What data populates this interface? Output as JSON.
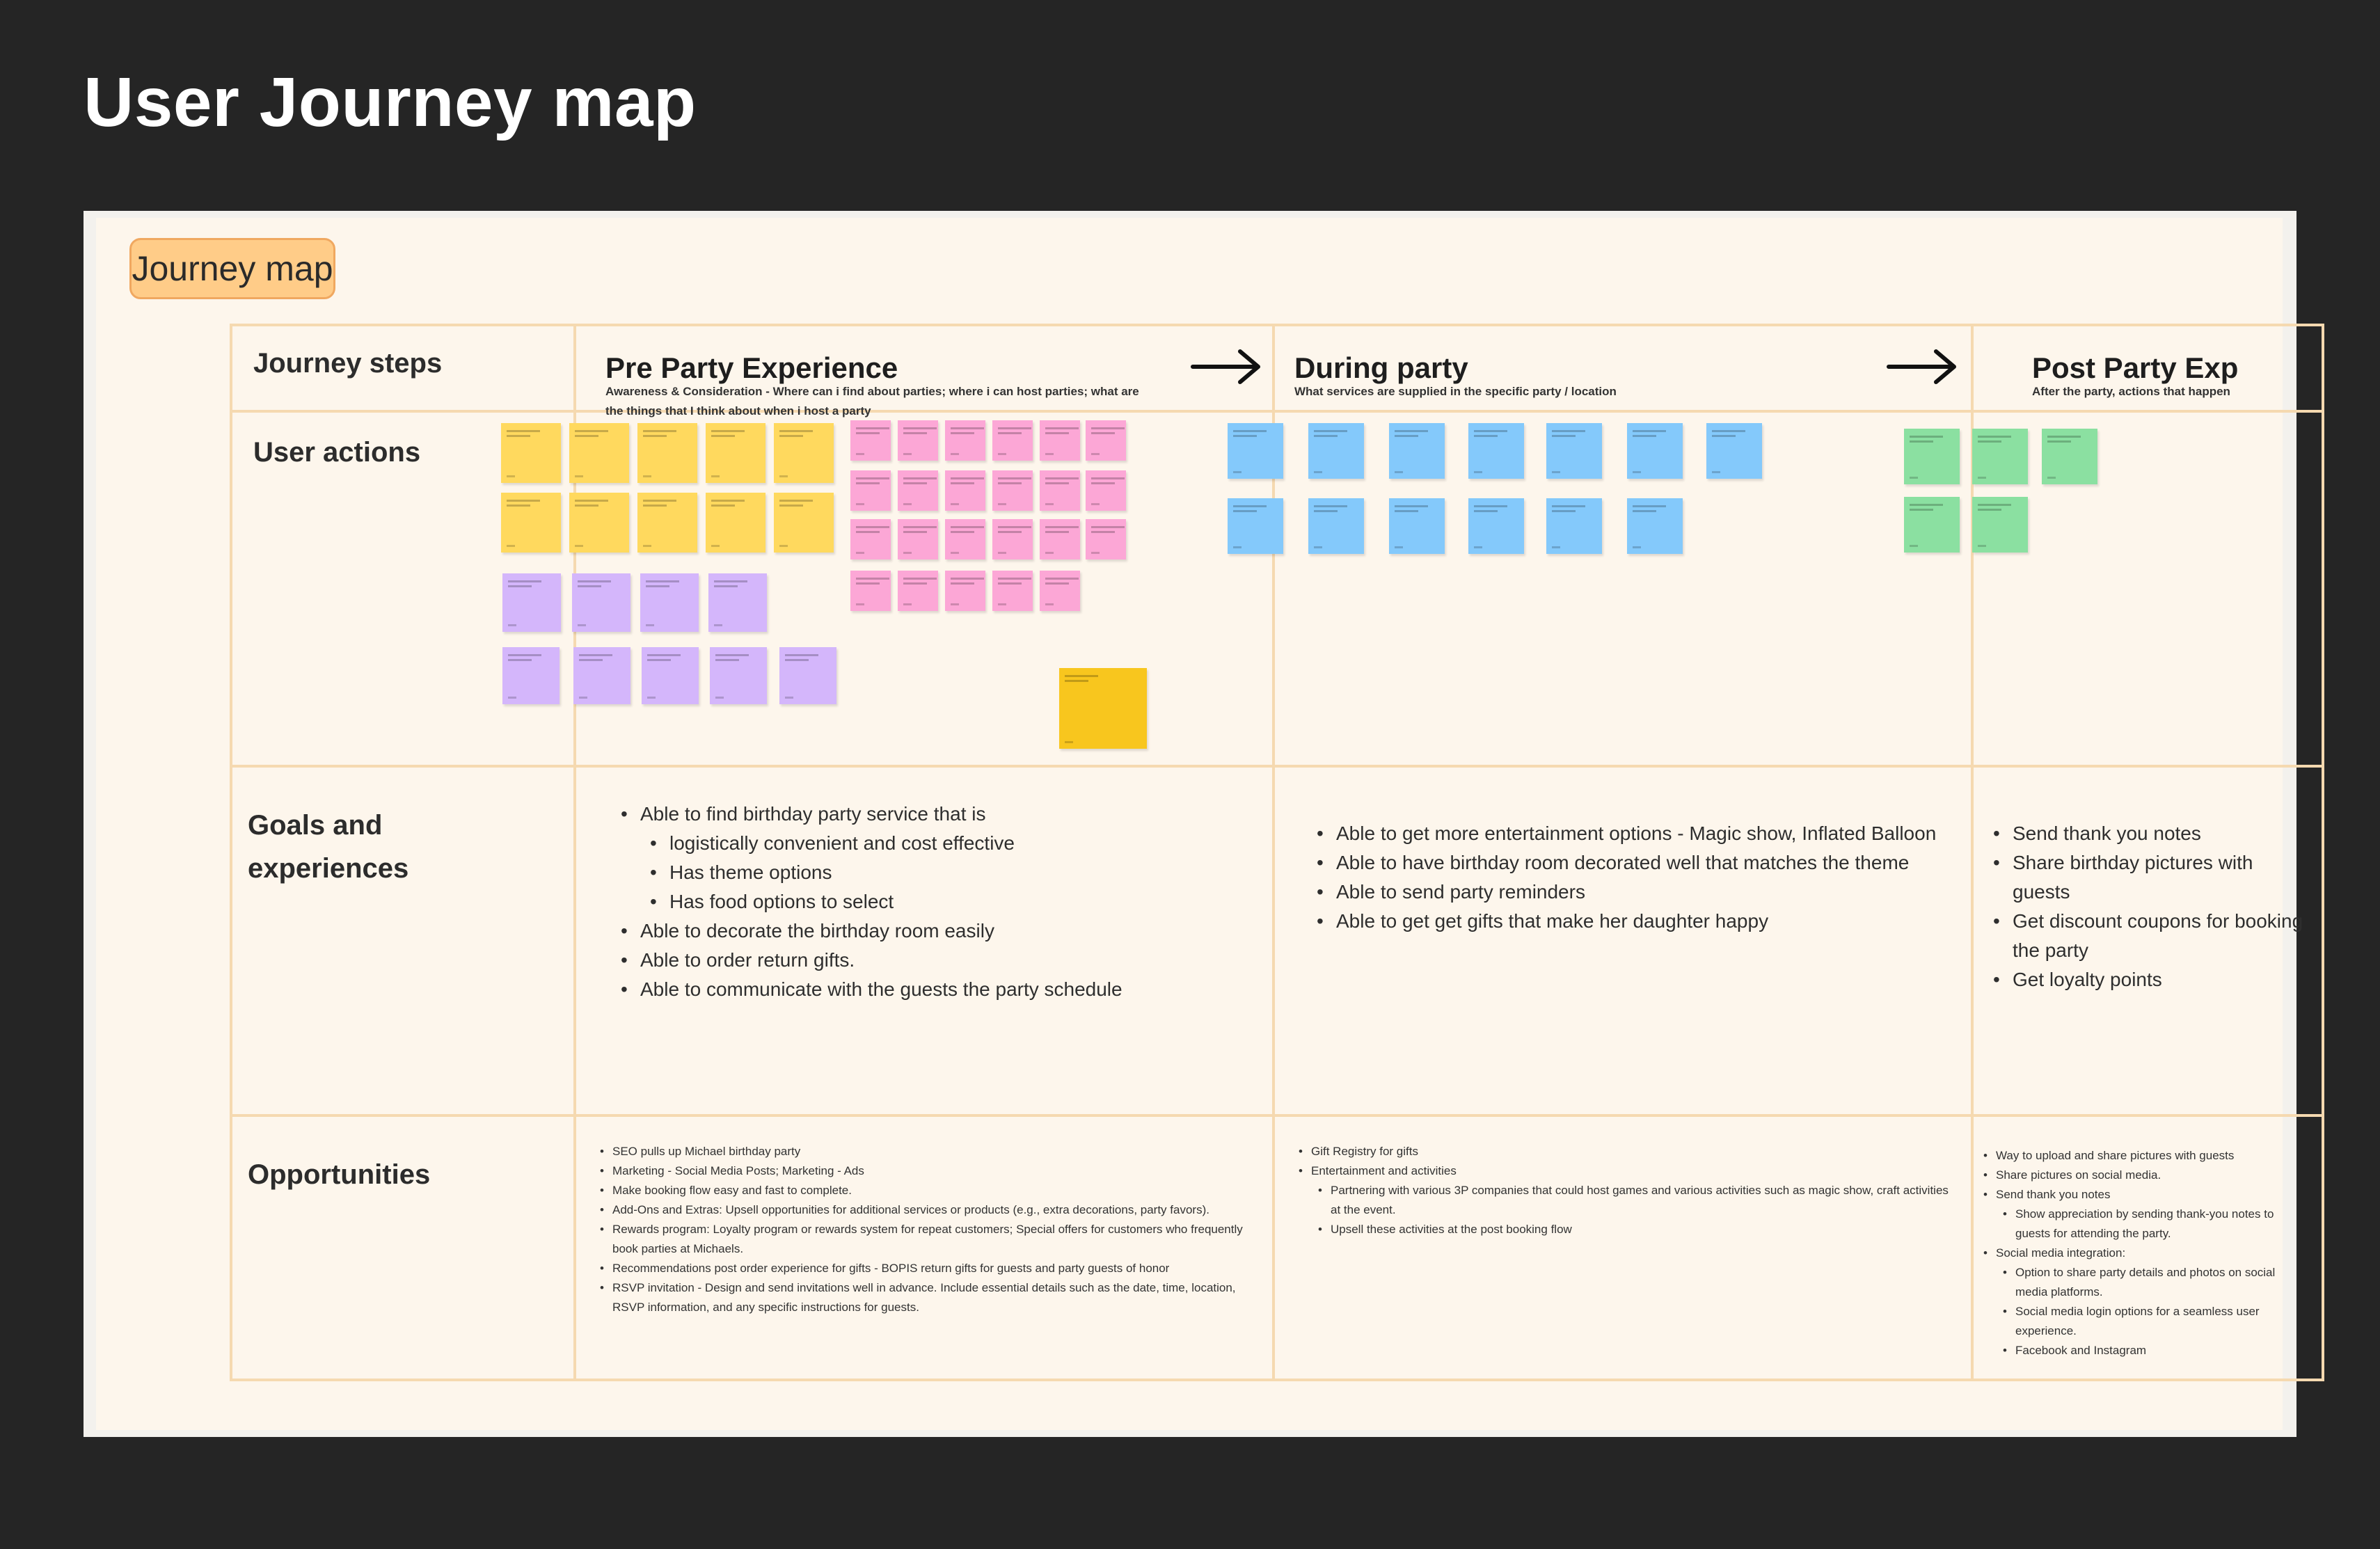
{
  "page": {
    "title": "User Journey map"
  },
  "board": {
    "tag": "Journey map",
    "row_labels": {
      "steps": "Journey steps",
      "actions": "User actions",
      "goals": "Goals and experiences",
      "opportunities": "Opportunities"
    },
    "phases": [
      {
        "title": "Pre Party Experience",
        "subtitle": "Awareness & Consideration - Where can i find about parties; where i can host parties; what are the things that I think about when i host a party"
      },
      {
        "title": "During party",
        "subtitle": "What services are supplied in the specific party / location"
      },
      {
        "title": "Post Party Exp",
        "subtitle": "After the party, actions that happen"
      }
    ],
    "sticky_colors": {
      "yellow": "#ffd95e",
      "pink": "#fca7d6",
      "purple": "#d4b6fb",
      "blue": "#84c9fb",
      "green": "#8be0a1",
      "highlight": "#f8c61e"
    },
    "goals": {
      "pre": [
        {
          "text": "Able to find birthday party service that is",
          "level": 0
        },
        {
          "text": "logistically convenient and cost effective",
          "level": 1
        },
        {
          "text": "Has theme options",
          "level": 1
        },
        {
          "text": "Has food options to select",
          "level": 1
        },
        {
          "text": "Able to decorate the birthday room easily",
          "level": 0
        },
        {
          "text": "Able to order return gifts.",
          "level": 0
        },
        {
          "text": "Able to communicate with the guests the party schedule",
          "level": 0
        }
      ],
      "during": [
        {
          "text": "Able to get more entertainment options - Magic show, Inflated Balloon",
          "level": 0
        },
        {
          "text": "Able to have birthday room decorated well that matches the theme",
          "level": 0
        },
        {
          "text": "Able to send party reminders",
          "level": 0
        },
        {
          "text": "Able to get get gifts that make her daughter happy",
          "level": 0
        }
      ],
      "post": [
        {
          "text": "Send thank you notes",
          "level": 0
        },
        {
          "text": "Share birthday pictures with guests",
          "level": 0
        },
        {
          "text": "Get discount coupons for booking the party",
          "level": 0
        },
        {
          "text": "Get loyalty points",
          "level": 0
        }
      ]
    },
    "opportunities": {
      "pre": [
        {
          "text": "SEO pulls up Michael birthday party",
          "level": 0
        },
        {
          "text": "Marketing - Social Media Posts; Marketing - Ads",
          "level": 0
        },
        {
          "text": "Make booking flow easy and fast to complete.",
          "level": 0
        },
        {
          "text": "Add-Ons and Extras: Upsell opportunities for additional services or products (e.g., extra decorations, party favors).",
          "level": 0
        },
        {
          "text": "Rewards program: Loyalty program or rewards system for repeat customers; Special offers for customers who frequently book parties at Michaels.",
          "level": 0
        },
        {
          "text": "Recommendations post order experience for gifts - BOPIS return gifts for guests and party guests of honor",
          "level": 0
        },
        {
          "text": "RSVP invitation - Design and send invitations well in advance. Include essential details such as the date, time, location, RSVP information, and any specific instructions for guests.",
          "level": 0
        }
      ],
      "during": [
        {
          "text": "Gift Registry for gifts",
          "level": 0
        },
        {
          "text": "Entertainment and activities",
          "level": 0
        },
        {
          "text": "Partnering with various 3P companies that could host games and various activities such as magic show, craft activities at the event.",
          "level": 1
        },
        {
          "text": "Upsell these activities at the post booking flow",
          "level": 1
        }
      ],
      "post": [
        {
          "text": "Way to upload and share pictures with guests",
          "level": 0
        },
        {
          "text": "Share pictures on social media.",
          "level": 0
        },
        {
          "text": "Send thank you notes",
          "level": 0
        },
        {
          "text": "Show appreciation by sending thank-you notes to guests for attending the party.",
          "level": 1
        },
        {
          "text": "Social media integration:",
          "level": 0
        },
        {
          "text": "Option to share party details and photos on social media platforms.",
          "level": 1
        },
        {
          "text": "Social media login options for a seamless user experience.",
          "level": 1
        },
        {
          "text": "Facebook and Instagram",
          "level": 1
        }
      ]
    }
  }
}
